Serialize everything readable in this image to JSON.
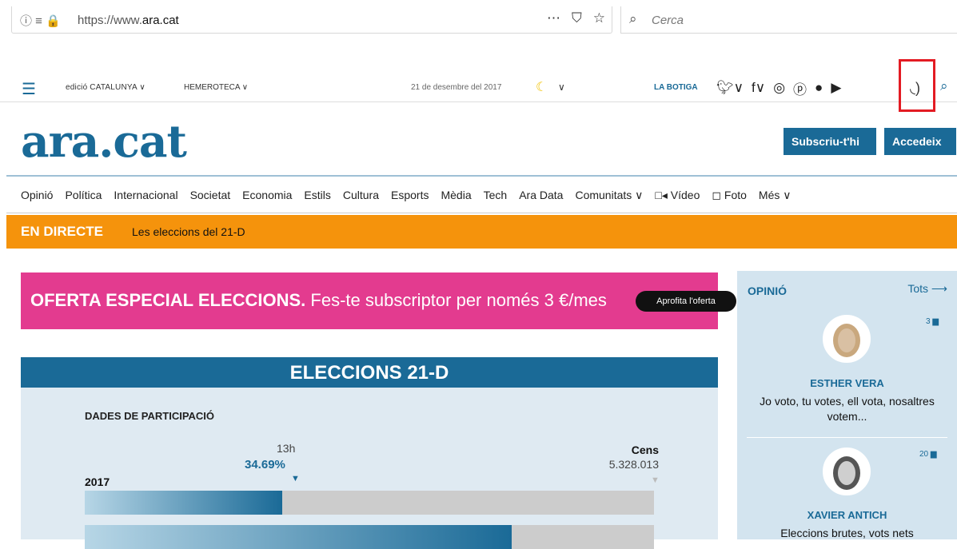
{
  "browser": {
    "url_prefix": "https://www.",
    "url_domain": "ara.cat",
    "search_placeholder": "Cerca",
    "more_icon": "⋯",
    "pocket_icon": "⛉",
    "star_icon": "☆"
  },
  "utility": {
    "edition": "edició CATALUNYA ∨",
    "archive": "HEMEROTECA ∨",
    "date": "21 de desembre del 2017",
    "shop": "LA BOTIGA"
  },
  "header": {
    "logo": "ara.cat",
    "subscribe": "Subscriu-t'hi",
    "login": "Accedeix"
  },
  "nav": [
    "Opinió",
    "Política",
    "Internacional",
    "Societat",
    "Economia",
    "Estils",
    "Cultura",
    "Esports",
    "Mèdia",
    "Tech",
    "Ara Data",
    "Comunitats ∨",
    "□◂ Vídeo",
    "◻ Foto",
    "Més ∨"
  ],
  "live": {
    "tag": "EN DIRECTE",
    "text": "Les eleccions del 21-D"
  },
  "promo": {
    "bold": "OFERTA ESPECIAL ELECCIONS.",
    "rest": " Fes-te subscriptor per només 3 €/mes",
    "cta": "Aprofita l'oferta"
  },
  "elections": {
    "title": "ELECCIONS 21-D",
    "subtitle": "DADES DE PARTICIPACIÓ",
    "hour": "13h",
    "percent": "34.69%",
    "year": "2017",
    "census_label": "Cens",
    "census_value": "5.328.013",
    "bar1_fraction": 0.3469,
    "bar2_fraction": 0.75
  },
  "sidebar": {
    "heading": "OPINIÓ",
    "all": "Tots ⟶",
    "authors": [
      {
        "comments": "3",
        "name": "ESTHER VERA",
        "headline": "Jo voto, tu votes, ell vota, nosaltres votem..."
      },
      {
        "comments": "20",
        "name": "XAVIER ANTICH",
        "headline": "Eleccions brutes, vots nets"
      }
    ]
  },
  "colors": {
    "brand": "#1a6a97",
    "live": "#f5930c",
    "promo": "#e33b8f",
    "rss_highlight": "#e31b23"
  }
}
